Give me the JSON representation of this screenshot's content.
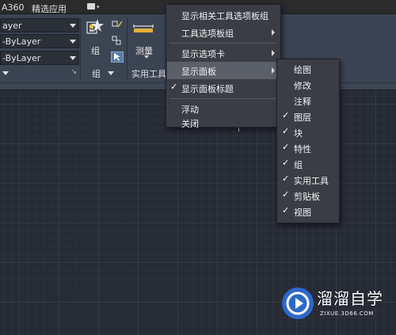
{
  "titlebar": {
    "tabs": [
      "A360",
      "精选应用"
    ]
  },
  "ribbon": {
    "bylayer_rows": [
      "ayer",
      "-ByLayer",
      "-ByLayer"
    ],
    "group_label": "组",
    "group_panel_title": "组",
    "measure_label": "测量",
    "util_panel_title": "实用工具"
  },
  "context_menu": {
    "items": [
      {
        "label": "显示相关工具选项板组",
        "checked": false,
        "submenu": false
      },
      {
        "label": "工具选项板组",
        "checked": false,
        "submenu": true
      },
      {
        "label": "显示选项卡",
        "checked": false,
        "submenu": true
      },
      {
        "label": "显示面板",
        "checked": false,
        "submenu": true,
        "highlighted": true
      },
      {
        "label": "显示面板标题",
        "checked": true,
        "submenu": false
      },
      {
        "label": "浮动",
        "checked": false,
        "submenu": false
      },
      {
        "label": "关闭",
        "checked": false,
        "submenu": false
      }
    ],
    "check_glyph": "✓"
  },
  "panels_submenu": {
    "items": [
      {
        "label": "绘图",
        "checked": false
      },
      {
        "label": "修改",
        "checked": false
      },
      {
        "label": "注释",
        "checked": false
      },
      {
        "label": "图层",
        "checked": true
      },
      {
        "label": "块",
        "checked": true
      },
      {
        "label": "特性",
        "checked": true
      },
      {
        "label": "组",
        "checked": true
      },
      {
        "label": "实用工具",
        "checked": true
      },
      {
        "label": "剪贴板",
        "checked": true
      },
      {
        "label": "视图",
        "checked": true
      }
    ]
  },
  "watermark": {
    "title": "溜溜自学",
    "url": "ZIXUE.3D66.COM"
  },
  "colors": {
    "ribbon": "#3b4453",
    "menu_bg": "#3a3d44",
    "menu_highlight": "#5b6068",
    "drawing_bg": "#262b35",
    "watermark_logo": "#2f6fd8"
  }
}
